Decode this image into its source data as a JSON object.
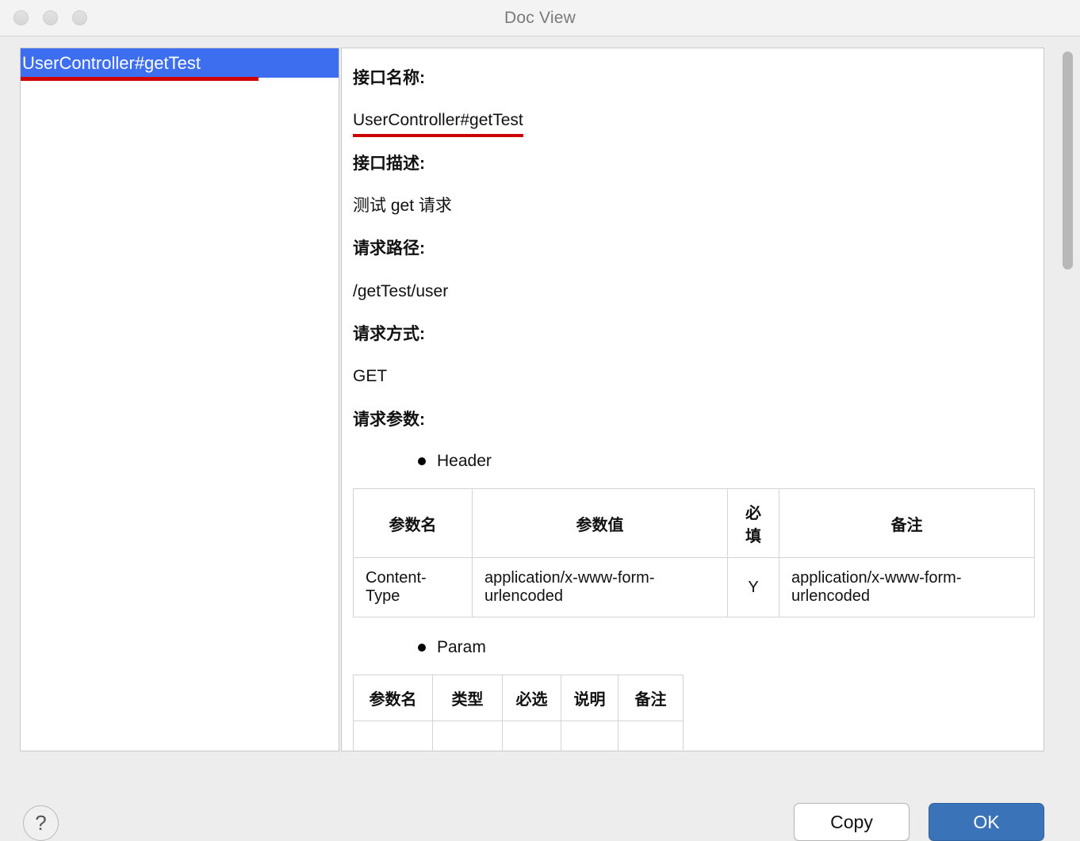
{
  "window": {
    "title": "Doc View",
    "traffic_lights": [
      "close",
      "minimize",
      "maximize"
    ]
  },
  "sidebar": {
    "items": [
      {
        "label": "UserController#getTest",
        "selected": true,
        "underlined": true
      }
    ]
  },
  "content": {
    "sections": [
      {
        "label": "接口名称:",
        "value": "UserController#getTest",
        "underlined": true
      },
      {
        "label": "接口描述:",
        "value": "测试 get 请求",
        "underlined": false
      },
      {
        "label": "请求路径:",
        "value": "/getTest/user",
        "underlined": false
      },
      {
        "label": "请求方式:",
        "value": "GET",
        "underlined": false
      }
    ],
    "params_label": "请求参数:",
    "header_group": {
      "bullet_label": "Header",
      "columns": [
        "参数名",
        "参数值",
        "必填",
        "备注"
      ],
      "rows": [
        [
          "Content-Type",
          "application/x-www-form-urlencoded",
          "Y",
          "application/x-www-form-urlencoded"
        ]
      ]
    },
    "param_group": {
      "bullet_label": "Param",
      "columns": [
        "参数名",
        "类型",
        "必选",
        "说明",
        "备注"
      ],
      "rows": [
        [
          "",
          "",
          "",
          "",
          ""
        ]
      ]
    }
  },
  "scrollbar": {
    "orientation": "vertical",
    "thumb_position_percent": 0,
    "thumb_size_percent": 31
  },
  "footer": {
    "help_glyph": "?",
    "copy_label": "Copy",
    "ok_label": "OK"
  },
  "colors": {
    "selection_blue": "#3d6ef0",
    "underline_red": "#cc0000",
    "primary_button_blue": "#3a73b8",
    "titlebar_bg": "#f3f3f3",
    "dialog_bg": "#ededed"
  }
}
